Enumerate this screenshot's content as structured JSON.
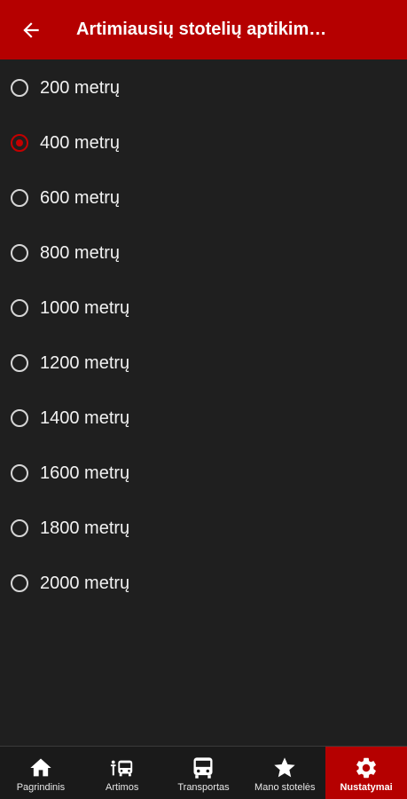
{
  "header": {
    "title": "Artimiausių stotelių aptikim…"
  },
  "options": [
    {
      "label": "200 metrų",
      "checked": false
    },
    {
      "label": "400 metrų",
      "checked": true
    },
    {
      "label": "600 metrų",
      "checked": false
    },
    {
      "label": "800 metrų",
      "checked": false
    },
    {
      "label": "1000 metrų",
      "checked": false
    },
    {
      "label": "1200 metrų",
      "checked": false
    },
    {
      "label": "1400 metrų",
      "checked": false
    },
    {
      "label": "1600 metrų",
      "checked": false
    },
    {
      "label": "1800 metrų",
      "checked": false
    },
    {
      "label": "2000 metrų",
      "checked": false
    }
  ],
  "nav": [
    {
      "label": "Pagrindinis",
      "icon": "home-icon",
      "active": false
    },
    {
      "label": "Artimos",
      "icon": "nearby-bus-icon",
      "active": false
    },
    {
      "label": "Transportas",
      "icon": "bus-icon",
      "active": false
    },
    {
      "label": "Mano stotelės",
      "icon": "star-icon",
      "active": false
    },
    {
      "label": "Nustatymai",
      "icon": "gear-icon",
      "active": true
    }
  ],
  "colors": {
    "accent": "#b50000",
    "background": "#1f1f1f",
    "radio_checked": "#c40000"
  }
}
